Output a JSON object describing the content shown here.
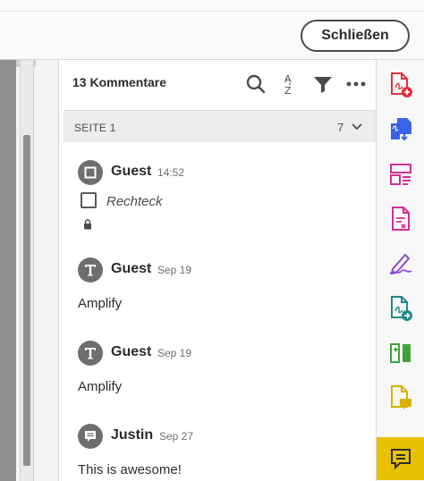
{
  "topbar": {
    "close_label": "Schließen"
  },
  "panel": {
    "title": "13 Kommentare",
    "section": {
      "label": "SEITE 1",
      "count": "7"
    }
  },
  "comments": [
    {
      "author": "Guest",
      "time": "14:52",
      "type": "rectangle",
      "subject": "Rechteck",
      "locked": true
    },
    {
      "author": "Guest",
      "time": "Sep 19",
      "type": "text",
      "body": "Amplify"
    },
    {
      "author": "Guest",
      "time": "Sep 19",
      "type": "text",
      "body": "Amplify"
    },
    {
      "author": "Justin",
      "time": "Sep 27",
      "type": "note",
      "body": "This is awesome!"
    }
  ],
  "icons": {
    "header": [
      "search-icon",
      "sort-icon",
      "filter-icon",
      "more-icon"
    ],
    "tools": [
      "add-pdf-icon",
      "export-pdf-icon",
      "organize-pages-icon",
      "edit-pdf-icon",
      "fill-sign-icon",
      "send-pdf-icon",
      "compare-icon",
      "comment-page-icon",
      "comment-icon"
    ]
  },
  "colors": {
    "active_tool": "#e8c200",
    "tool_red": "#e0313d",
    "tool_blue": "#3b63e8",
    "tool_magenta": "#d62d9a",
    "tool_purple": "#8a4fd6",
    "tool_teal": "#1f8a8a",
    "tool_green": "#3ea33a",
    "tool_yellow": "#d9b100"
  }
}
